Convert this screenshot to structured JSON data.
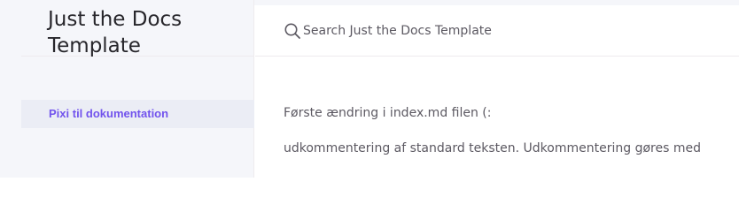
{
  "site": {
    "title": "Just the Docs Template"
  },
  "sidebar": {
    "items": [
      {
        "label": "Pixi til dokumentation"
      }
    ]
  },
  "search": {
    "placeholder": "Search Just the Docs Template",
    "value": ""
  },
  "main": {
    "paragraphs": [
      "Første ændring i index.md filen (:",
      "udkommentering af standard teksten. Udkommentering gøres med"
    ]
  },
  "colors": {
    "accent": "#7253ed",
    "sidebar_bg": "#f5f6fa",
    "text": "#5c5962",
    "title": "#27262b"
  },
  "icons": {
    "search": "search-icon"
  }
}
